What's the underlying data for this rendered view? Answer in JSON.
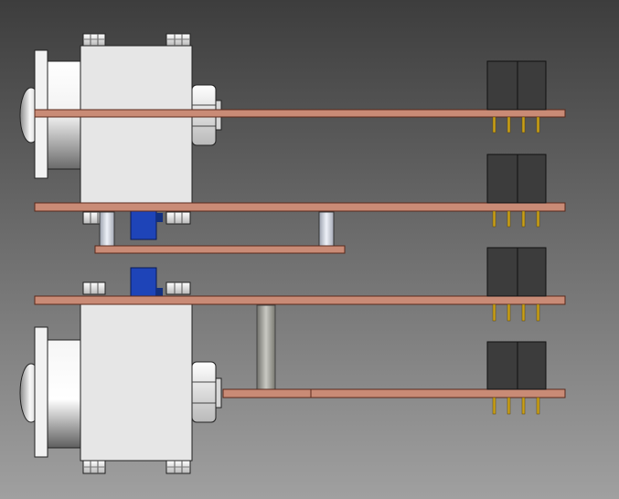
{
  "viewport": {
    "background": {
      "top": "#3d3d3d",
      "bottom": "#a0a0a0"
    }
  },
  "colors": {
    "pcb": "#c98b76",
    "pcb_edge": "#5a2a1c",
    "motor_body": "#e6e6e6",
    "metal_light": "#f4f4f4",
    "metal_dark": "#6e6e6e",
    "connector": "#3c3c3c",
    "pin": "#c9a019",
    "blue_part": "#1e44b8",
    "standoff_light": "#d7dbe6",
    "rod": "#9a9a94"
  },
  "assembly": {
    "motors": [
      {
        "id": "upper-motor"
      },
      {
        "id": "lower-motor"
      }
    ],
    "boards": [
      {
        "id": "board-1"
      },
      {
        "id": "board-2"
      },
      {
        "id": "board-3"
      },
      {
        "id": "board-4"
      },
      {
        "id": "board-5"
      }
    ],
    "connectors": [
      {
        "id": "header-connector-1"
      },
      {
        "id": "header-connector-2"
      },
      {
        "id": "header-connector-3"
      },
      {
        "id": "header-connector-4"
      }
    ],
    "blue_components": [
      {
        "id": "blue-component-1"
      },
      {
        "id": "blue-component-2"
      }
    ]
  }
}
